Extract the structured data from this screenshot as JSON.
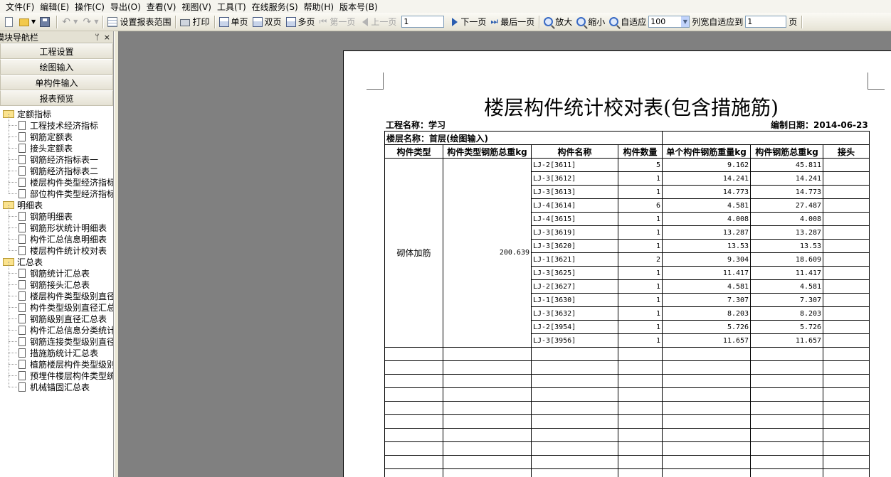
{
  "menu": [
    "文件(F)",
    "编辑(E)",
    "操作(C)",
    "导出(O)",
    "查看(V)",
    "视图(V)",
    "工具(T)",
    "在线服务(S)",
    "帮助(H)",
    "版本号(B)"
  ],
  "toolbar": {
    "set_range": "设置报表范围",
    "print": "打印",
    "single_page": "单页",
    "double_page": "双页",
    "multi_page": "多页",
    "first_page": "第一页",
    "prev_page": "上一页",
    "page_value": "1",
    "next_page": "下一页",
    "last_page": "最后一页",
    "zoom_in": "放大",
    "zoom_out": "缩小",
    "fit": "自适应",
    "zoom_value": "100",
    "col_fit": "列宽自适应到",
    "col_fit_value": "1",
    "page_unit": "页"
  },
  "nav": {
    "title": "模块导航栏",
    "pin": "ᛘ",
    "close": "×",
    "buttons": [
      "工程设置",
      "绘图输入",
      "单构件输入",
      "报表预览"
    ],
    "tree": [
      {
        "label": "定额指标",
        "children": [
          "工程技术经济指标",
          "钢筋定额表",
          "接头定额表",
          "钢筋经济指标表一",
          "钢筋经济指标表二",
          "楼层构件类型经济指标",
          "部位构件类型经济指标"
        ]
      },
      {
        "label": "明细表",
        "children": [
          "钢筋明细表",
          "钢筋形状统计明细表",
          "构件汇总信息明细表",
          "楼层构件统计校对表"
        ]
      },
      {
        "label": "汇总表",
        "children": [
          "钢筋统计汇总表",
          "钢筋接头汇总表",
          "楼层构件类型级别直径",
          "构件类型级别直径汇总",
          "钢筋级别直径汇总表",
          "构件汇总信息分类统计",
          "钢筋连接类型级别直径",
          "措施筋统计汇总表",
          "植筋楼层构件类型级别",
          "预埋件楼层构件类型统",
          "机械锚固汇总表"
        ]
      }
    ]
  },
  "report": {
    "title": "楼层构件统计校对表(包含措施筋)",
    "project": "工程名称：学习",
    "date": "编制日期：2014-06-23",
    "floor": "楼层名称：首层(绘图输入)",
    "headers": [
      "构件类型",
      "构件类型钢筋总重kg",
      "构件名称",
      "构件数量",
      "单个构件钢筋重量kg",
      "构件钢筋总重kg",
      "接头"
    ],
    "group_type": "砌体加筋",
    "group_total": "200.639",
    "rows": [
      [
        "LJ-2[3611]",
        "5",
        "9.162",
        "45.811"
      ],
      [
        "LJ-3[3612]",
        "1",
        "14.241",
        "14.241"
      ],
      [
        "LJ-3[3613]",
        "1",
        "14.773",
        "14.773"
      ],
      [
        "LJ-4[3614]",
        "6",
        "4.581",
        "27.487"
      ],
      [
        "LJ-4[3615]",
        "1",
        "4.008",
        "4.008"
      ],
      [
        "LJ-3[3619]",
        "1",
        "13.287",
        "13.287"
      ],
      [
        "LJ-3[3620]",
        "1",
        "13.53",
        "13.53"
      ],
      [
        "LJ-1[3621]",
        "2",
        "9.304",
        "18.609"
      ],
      [
        "LJ-3[3625]",
        "1",
        "11.417",
        "11.417"
      ],
      [
        "LJ-2[3627]",
        "1",
        "4.581",
        "4.581"
      ],
      [
        "LJ-1[3630]",
        "1",
        "7.307",
        "7.307"
      ],
      [
        "LJ-3[3632]",
        "1",
        "8.203",
        "8.203"
      ],
      [
        "LJ-2[3954]",
        "1",
        "5.726",
        "5.726"
      ],
      [
        "LJ-3[3956]",
        "1",
        "11.657",
        "11.657"
      ]
    ]
  }
}
